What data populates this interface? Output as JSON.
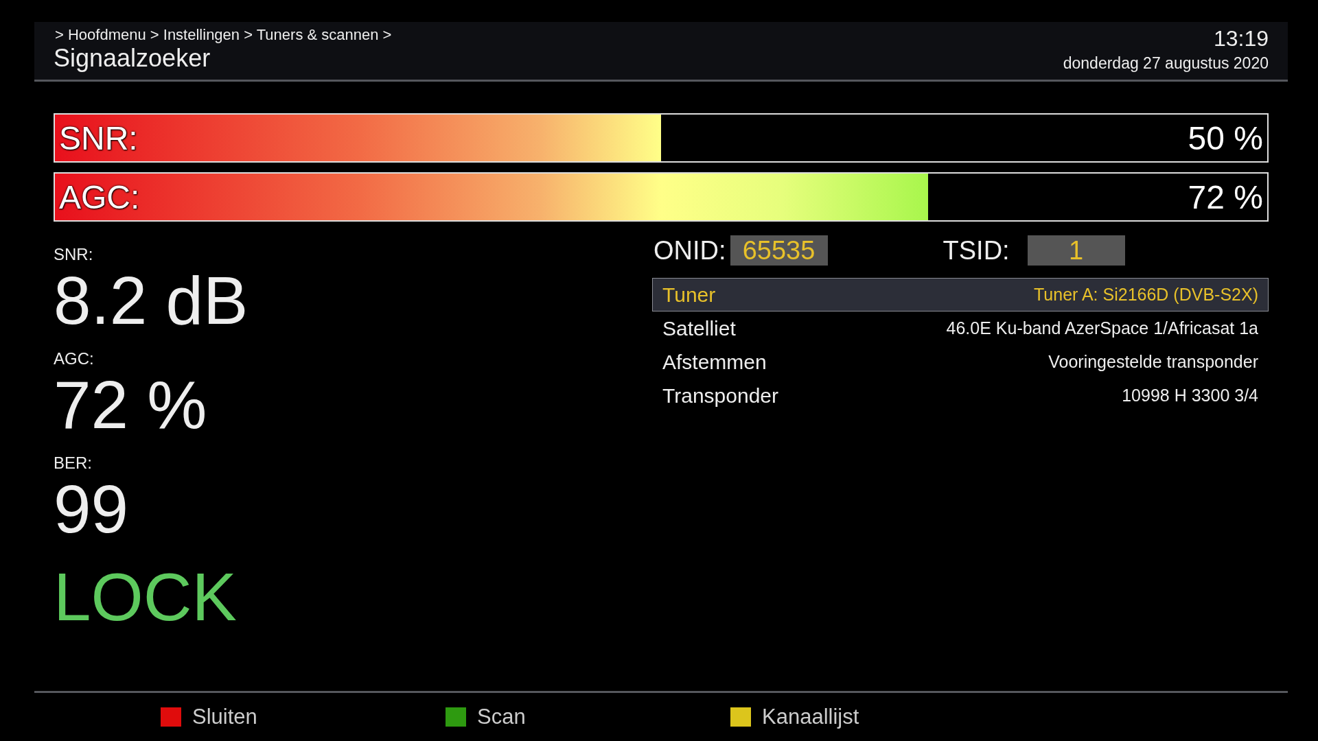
{
  "header": {
    "breadcrumb": " > Hoofdmenu > Instellingen > Tuners & scannen >",
    "title": "Signaalzoeker",
    "time": "13:19",
    "date": "donderdag 27 augustus 2020"
  },
  "bars": [
    {
      "label": "SNR:",
      "level": 0.5,
      "reading": "50 %"
    },
    {
      "label": "AGC:",
      "level": 0.72,
      "reading": "72 %"
    }
  ],
  "readings": [
    {
      "label": "SNR:",
      "value": "8.2 dB"
    },
    {
      "label": "AGC:",
      "value": "72 %"
    },
    {
      "label": "BER:",
      "value": "99"
    }
  ],
  "lock_status": "LOCK",
  "ids": [
    {
      "label": "ONID:",
      "value": "65535"
    },
    {
      "label": "TSID:",
      "value": "1"
    }
  ],
  "info_rows": [
    {
      "label": "Tuner",
      "value": "Tuner A: Si2166D (DVB-S2X)",
      "selected": true
    },
    {
      "label": "Satelliet",
      "value": "46.0E Ku-band AzerSpace 1/Africasat 1a",
      "selected": false
    },
    {
      "label": "Afstemmen",
      "value": "Vooringestelde transponder",
      "selected": false
    },
    {
      "label": "Transponder",
      "value": "10998 H 3300 3/4",
      "selected": false
    }
  ],
  "footer_buttons": [
    {
      "label": "Sluiten",
      "color": "#e00c0c"
    },
    {
      "label": "Scan",
      "color": "#2e9a10"
    },
    {
      "label": "Kanaallijst",
      "color": "#dcc51c"
    }
  ]
}
